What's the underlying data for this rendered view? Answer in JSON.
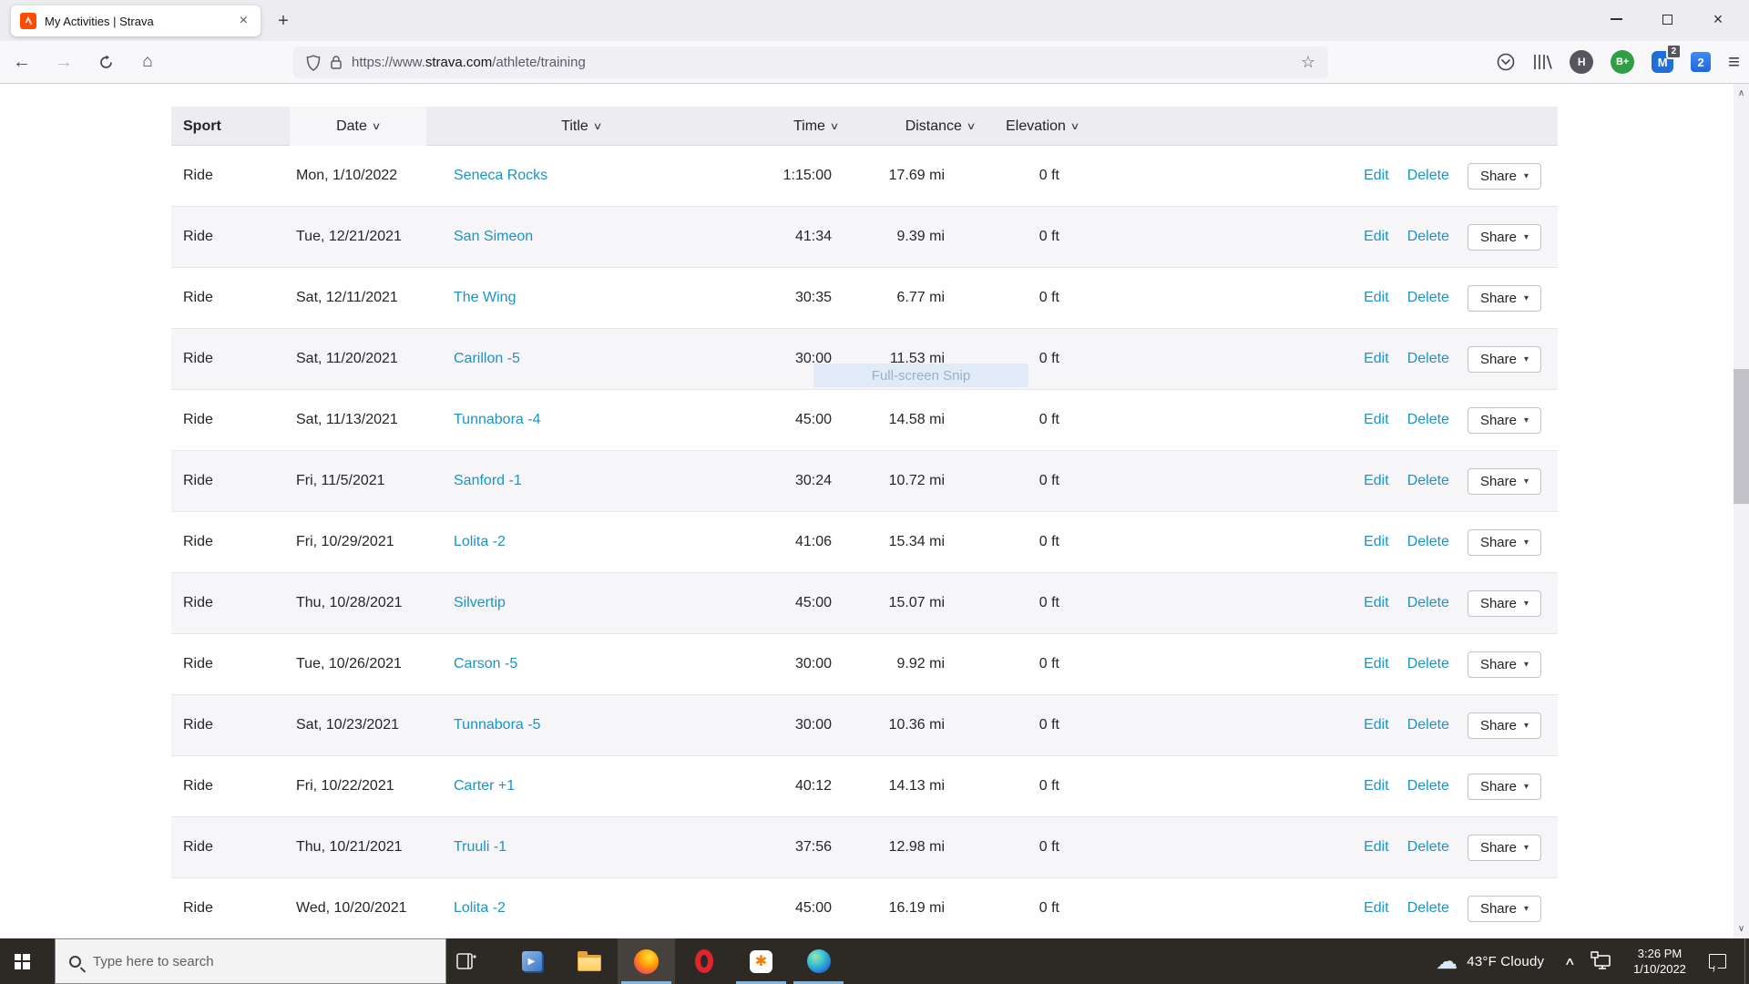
{
  "browser": {
    "tab_title": "My Activities | Strava",
    "close_tab_glyph": "×",
    "new_tab_glyph": "+",
    "back_glyph": "←",
    "forward_glyph": "→",
    "home_glyph": "⌂",
    "star_glyph": "☆",
    "menu_glyph": "≡",
    "url": {
      "prefix": "https://www.",
      "domain": "strava.com",
      "path": "/athlete/training"
    },
    "extensions": {
      "h_label": "H",
      "b_label": "B+",
      "m_label": "M",
      "m_badge": "2",
      "two_label": "2"
    }
  },
  "page": {
    "ghost_tooltip": "Full-screen Snip",
    "actions": {
      "edit": "Edit",
      "delete": "Delete",
      "share": "Share"
    },
    "table": {
      "headers": [
        {
          "label": "Sport",
          "caret": false,
          "highlight": false
        },
        {
          "label": "Date",
          "caret": true,
          "highlight": true
        },
        {
          "label": "Title",
          "caret": true,
          "highlight": false
        },
        {
          "label": "Time",
          "caret": true,
          "highlight": false
        },
        {
          "label": "Distance",
          "caret": true,
          "highlight": false
        },
        {
          "label": "Elevation",
          "caret": true,
          "highlight": false
        }
      ],
      "rows": [
        {
          "sport": "Ride",
          "date": "Mon, 1/10/2022",
          "title": "Seneca Rocks",
          "time": "1:15:00",
          "distance": "17.69 mi",
          "elevation": "0 ft"
        },
        {
          "sport": "Ride",
          "date": "Tue, 12/21/2021",
          "title": "San Simeon",
          "time": "41:34",
          "distance": "9.39 mi",
          "elevation": "0 ft"
        },
        {
          "sport": "Ride",
          "date": "Sat, 12/11/2021",
          "title": "The Wing",
          "time": "30:35",
          "distance": "6.77 mi",
          "elevation": "0 ft"
        },
        {
          "sport": "Ride",
          "date": "Sat, 11/20/2021",
          "title": "Carillon -5",
          "time": "30:00",
          "distance": "11.53 mi",
          "elevation": "0 ft"
        },
        {
          "sport": "Ride",
          "date": "Sat, 11/13/2021",
          "title": "Tunnabora -4",
          "time": "45:00",
          "distance": "14.58 mi",
          "elevation": "0 ft"
        },
        {
          "sport": "Ride",
          "date": "Fri, 11/5/2021",
          "title": "Sanford -1",
          "time": "30:24",
          "distance": "10.72 mi",
          "elevation": "0 ft"
        },
        {
          "sport": "Ride",
          "date": "Fri, 10/29/2021",
          "title": "Lolita -2",
          "time": "41:06",
          "distance": "15.34 mi",
          "elevation": "0 ft"
        },
        {
          "sport": "Ride",
          "date": "Thu, 10/28/2021",
          "title": "Silvertip",
          "time": "45:00",
          "distance": "15.07 mi",
          "elevation": "0 ft"
        },
        {
          "sport": "Ride",
          "date": "Tue, 10/26/2021",
          "title": "Carson -5",
          "time": "30:00",
          "distance": "9.92 mi",
          "elevation": "0 ft"
        },
        {
          "sport": "Ride",
          "date": "Sat, 10/23/2021",
          "title": "Tunnabora -5",
          "time": "30:00",
          "distance": "10.36 mi",
          "elevation": "0 ft"
        },
        {
          "sport": "Ride",
          "date": "Fri, 10/22/2021",
          "title": "Carter +1",
          "time": "40:12",
          "distance": "14.13 mi",
          "elevation": "0 ft"
        },
        {
          "sport": "Ride",
          "date": "Thu, 10/21/2021",
          "title": "Truuli -1",
          "time": "37:56",
          "distance": "12.98 mi",
          "elevation": "0 ft"
        },
        {
          "sport": "Ride",
          "date": "Wed, 10/20/2021",
          "title": "Lolita -2",
          "time": "45:00",
          "distance": "16.19 mi",
          "elevation": "0 ft"
        }
      ]
    }
  },
  "taskbar": {
    "search_placeholder": "Type here to search",
    "tray": {
      "weather": "43°F Cloudy",
      "time": "3:26 PM",
      "date": "1/10/2022"
    }
  },
  "icons": {
    "caret_down": "∨",
    "share_caret": "▾",
    "scroll_up": "∧",
    "scroll_down": "∨",
    "cloud": "☁",
    "tray_chevron": "∧",
    "avast_burst": "✱",
    "play": "▶"
  },
  "colors": {
    "link": "#1d93c4",
    "strava_orange": "#fc4c02",
    "taskbar_indicator": "#78b9e8"
  }
}
